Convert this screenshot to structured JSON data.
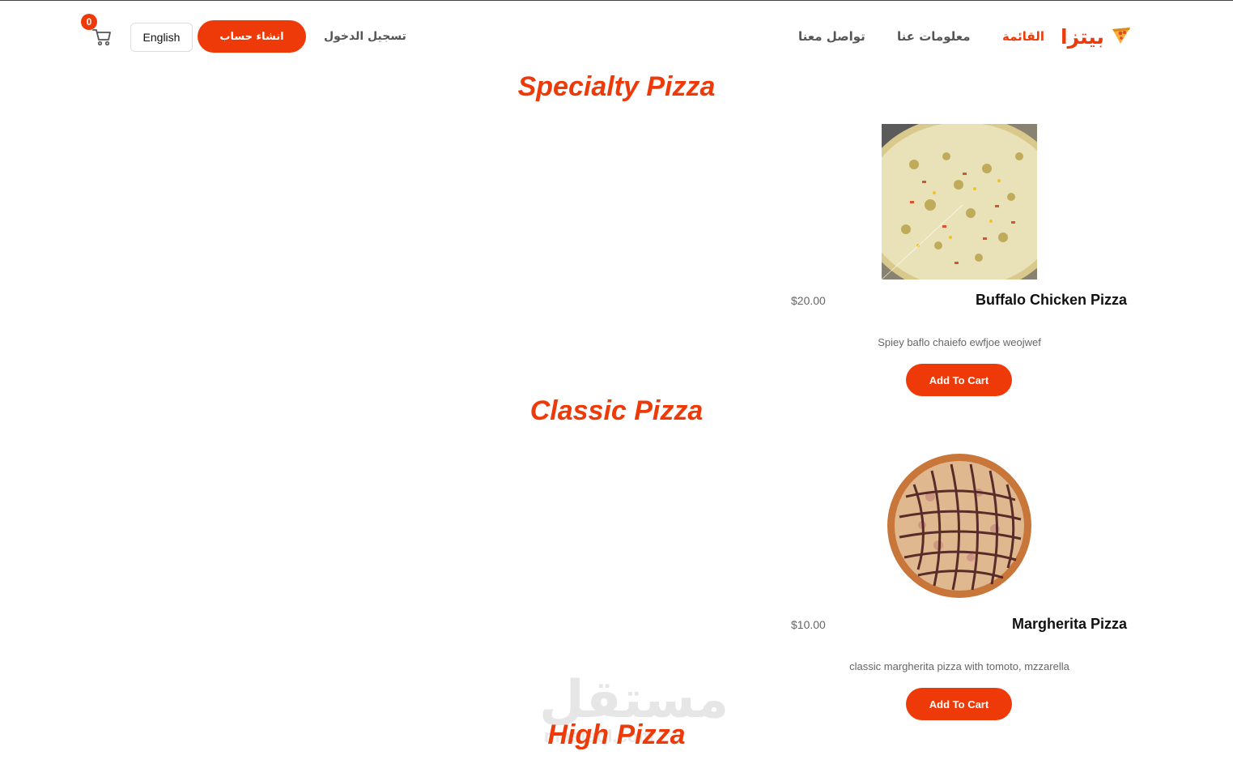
{
  "header": {
    "brand_name": "بيتزا",
    "nav": {
      "menu": "القائمة",
      "about": "معلومات عنا",
      "contact": "تواصل معنا"
    },
    "login": "تسجيل الدخول",
    "signup": "انشاء حساب",
    "language": "English",
    "cart_count": "0"
  },
  "sections": [
    {
      "title": "Specialty Pizza",
      "product": {
        "name": "Buffalo Chicken Pizza",
        "price": "$20.00",
        "description": "Spiey baflo chaiefo ewfjoe weojwef",
        "button": "Add To Cart"
      }
    },
    {
      "title": "Classic Pizza",
      "product": {
        "name": "Margherita Pizza",
        "price": "$10.00",
        "description": "classic margherita pizza with tomoto, mzzarella",
        "button": "Add To Cart"
      }
    },
    {
      "title": "High Pizza"
    }
  ],
  "watermark": {
    "arabic": "مستقل",
    "latin": "mostaql.com"
  },
  "colors": {
    "accent": "#ee3a09",
    "text_muted": "#666666"
  }
}
